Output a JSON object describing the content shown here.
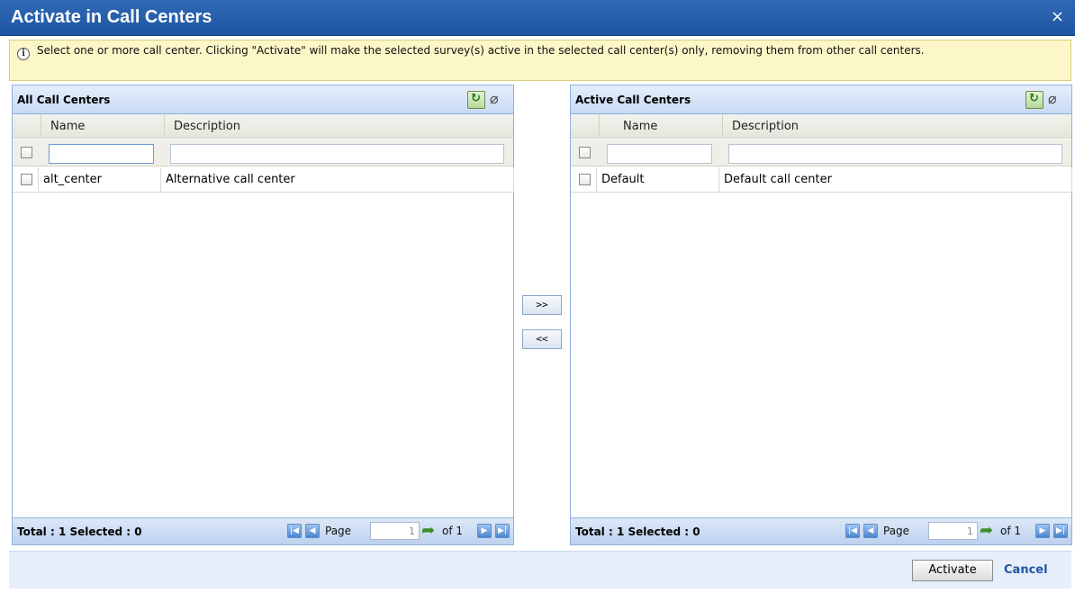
{
  "dialog": {
    "title": "Activate in Call Centers",
    "close_glyph": "×",
    "notice": "Select one or more call center. Clicking \"Activate\" will make the selected survey(s) active in the selected call center(s) only, removing them from other call centers."
  },
  "left_panel": {
    "title": "All Call Centers",
    "columns": {
      "name": "Name",
      "description": "Description"
    },
    "filter": {
      "name_value": "",
      "description_value": ""
    },
    "rows": [
      {
        "name": "alt_center",
        "description": "Alternative call center"
      }
    ],
    "footer": {
      "total": "Total : 1 Selected : 0",
      "page_label": "Page",
      "page_value": "1",
      "of_label": "of 1"
    }
  },
  "right_panel": {
    "title": "Active Call Centers",
    "columns": {
      "name": "Name",
      "description": "Description"
    },
    "filter": {
      "name_value": "",
      "description_value": ""
    },
    "rows": [
      {
        "name": "Default",
        "description": "Default call center"
      }
    ],
    "footer": {
      "total": "Total : 1 Selected : 0",
      "page_label": "Page",
      "page_value": "1",
      "of_label": "of 1"
    }
  },
  "move": {
    "add": ">>",
    "remove": "<<"
  },
  "actions": {
    "activate": "Activate",
    "cancel": "Cancel"
  },
  "icons": [
    "info-icon",
    "refresh-icon",
    "eraser-icon",
    "first-page-icon",
    "prev-page-icon",
    "go-arrow-icon",
    "next-page-icon",
    "last-page-icon",
    "close-icon"
  ],
  "colors": {
    "title_bar": "#2f68b4",
    "notice_bg": "#fbf7c8",
    "panel_header": "#c8daf4",
    "cancel_link": "#1f56a3"
  }
}
